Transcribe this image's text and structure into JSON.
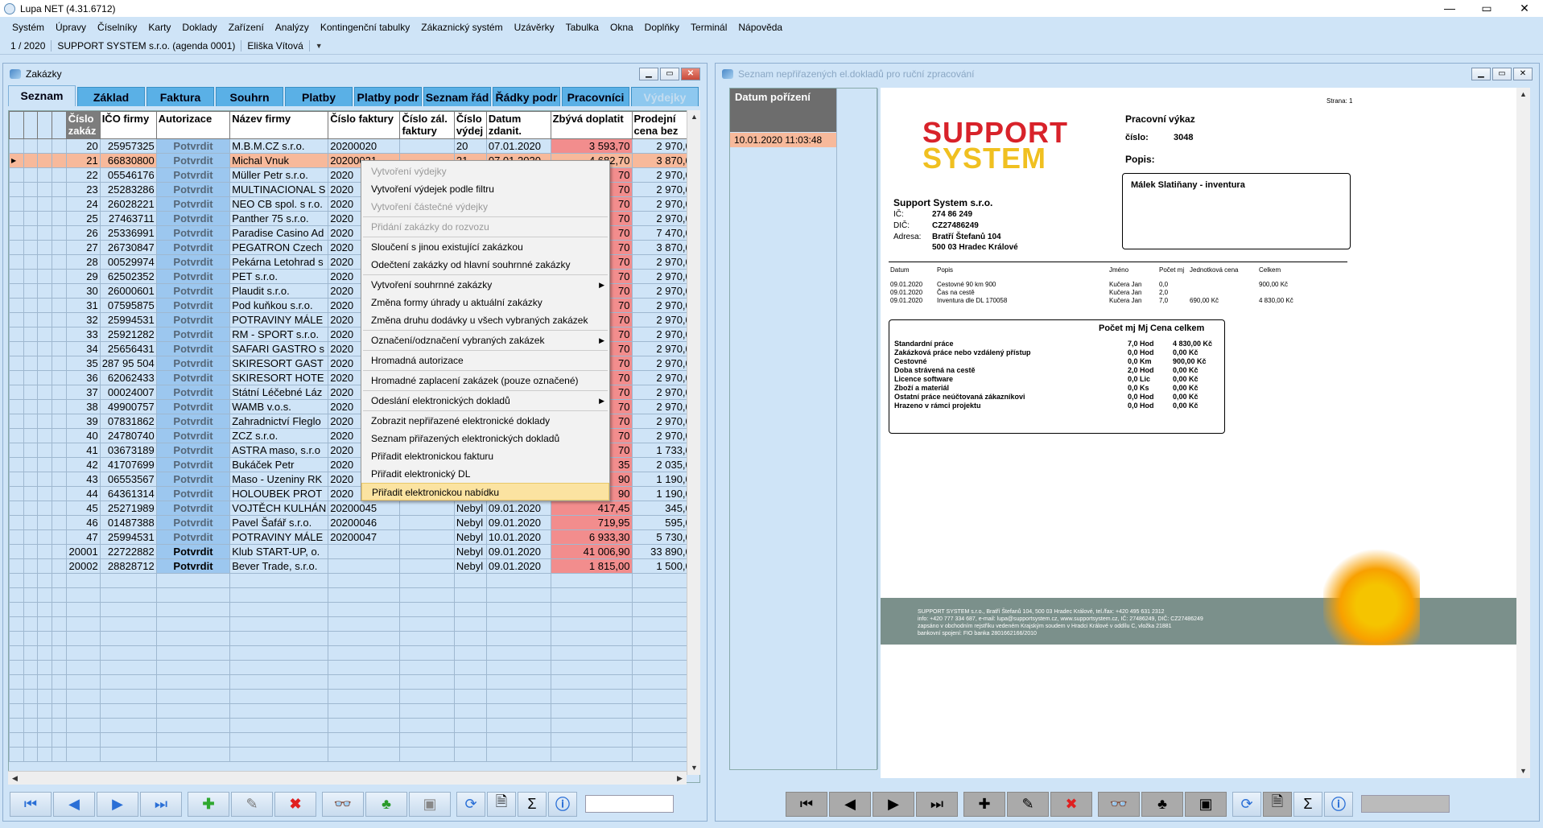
{
  "app": {
    "title": "Lupa NET (4.31.6712)",
    "minimize": "—",
    "maximize": "▭",
    "close": "✕"
  },
  "menu": [
    "Systém",
    "Úpravy",
    "Číselníky",
    "Karty",
    "Doklady",
    "Zařízení",
    "Analýzy",
    "Kontingenční tabulky",
    "Zákaznický systém",
    "Uzávěrky",
    "Tabulka",
    "Okna",
    "Doplňky",
    "Terminál",
    "Nápověda"
  ],
  "status": {
    "period": "1 / 2020",
    "company": "SUPPORT SYSTEM s.r.o.  (agenda 0001)",
    "user": "Eliška Vítová"
  },
  "left_window": {
    "title": "Zakázky",
    "tabs": [
      "Seznam",
      "Základ",
      "Faktura",
      "Souhrn",
      "Platby",
      "Platby podr",
      "Seznam řád",
      "Řádky podr",
      "Pracovníci",
      "Výdejky"
    ],
    "columns": [
      "Číslo zakáz",
      "IČO firmy",
      "Autorizace",
      "Název firmy",
      "Číslo faktury",
      "Číslo zál. faktury",
      "Číslo výdej",
      "Datum zdanit.",
      "Zbývá doplatit",
      "Prodejní cena bez"
    ],
    "rows": [
      [
        "20",
        "25957325",
        "Potvrdit",
        "M.B.M.CZ s.r.o.",
        "20200020",
        "",
        "20",
        "07.01.2020",
        "3 593,70",
        "2 970,00"
      ],
      [
        "21",
        "66830800",
        "Potvrdit",
        "Michal Vnuk",
        "20200021",
        "",
        "21",
        "07.01.2020",
        "4 682,70",
        "3 870,00"
      ],
      [
        "22",
        "05546176",
        "Potvrdit",
        "Müller Petr s.r.o.",
        "2020",
        "",
        "",
        "",
        "70",
        "2 970,00"
      ],
      [
        "23",
        "25283286",
        "Potvrdit",
        "MULTINACIONAL S",
        "2020",
        "",
        "",
        "",
        "70",
        "2 970,00"
      ],
      [
        "24",
        "26028221",
        "Potvrdit",
        "NEO CB spol. s r.o.",
        "2020",
        "",
        "",
        "",
        "70",
        "2 970,00"
      ],
      [
        "25",
        "27463711",
        "Potvrdit",
        "Panther 75 s.r.o.",
        "2020",
        "",
        "",
        "",
        "70",
        "2 970,00"
      ],
      [
        "26",
        "25336991",
        "Potvrdit",
        "Paradise Casino Ad",
        "2020",
        "",
        "",
        "",
        "70",
        "7 470,00"
      ],
      [
        "27",
        "26730847",
        "Potvrdit",
        "PEGATRON Czech",
        "2020",
        "",
        "",
        "",
        "70",
        "3 870,00"
      ],
      [
        "28",
        "00529974",
        "Potvrdit",
        "Pekárna Letohrad s",
        "2020",
        "",
        "",
        "",
        "70",
        "2 970,00"
      ],
      [
        "29",
        "62502352",
        "Potvrdit",
        "PET s.r.o.",
        "2020",
        "",
        "",
        "",
        "70",
        "2 970,00"
      ],
      [
        "30",
        "26000601",
        "Potvrdit",
        "Plaudit s.r.o.",
        "2020",
        "",
        "",
        "",
        "70",
        "2 970,00"
      ],
      [
        "31",
        "07595875",
        "Potvrdit",
        "Pod kuňkou s.r.o.",
        "2020",
        "",
        "",
        "",
        "70",
        "2 970,00"
      ],
      [
        "32",
        "25994531",
        "Potvrdit",
        "POTRAVINY MÁLE",
        "2020",
        "",
        "",
        "",
        "70",
        "2 970,00"
      ],
      [
        "33",
        "25921282",
        "Potvrdit",
        "RM - SPORT s.r.o.",
        "2020",
        "",
        "",
        "",
        "70",
        "2 970,00"
      ],
      [
        "34",
        "25656431",
        "Potvrdit",
        "SAFARI GASTRO s",
        "2020",
        "",
        "",
        "",
        "70",
        "2 970,00"
      ],
      [
        "35",
        "287 95 504",
        "Potvrdit",
        "SKIRESORT GAST",
        "2020",
        "",
        "",
        "",
        "70",
        "2 970,00"
      ],
      [
        "36",
        "62062433",
        "Potvrdit",
        "SKIRESORT HOTE",
        "2020",
        "",
        "",
        "",
        "70",
        "2 970,00"
      ],
      [
        "37",
        "00024007",
        "Potvrdit",
        "Státní Léčebné Láz",
        "2020",
        "",
        "",
        "",
        "70",
        "2 970,00"
      ],
      [
        "38",
        "49900757",
        "Potvrdit",
        "WAMB v.o.s.",
        "2020",
        "",
        "",
        "",
        "70",
        "2 970,00"
      ],
      [
        "39",
        "07831862",
        "Potvrdit",
        "Zahradnictví Fleglo",
        "2020",
        "",
        "",
        "",
        "70",
        "2 970,00"
      ],
      [
        "40",
        "24780740",
        "Potvrdit",
        "ZCZ s.r.o.",
        "2020",
        "",
        "",
        "",
        "70",
        "2 970,00"
      ],
      [
        "41",
        "03673189",
        "Potvrdit",
        "ASTRA maso, s.r.o",
        "2020",
        "",
        "",
        "",
        "70",
        "1 733,06"
      ],
      [
        "42",
        "41707699",
        "Potvrdit",
        "Bukáček Petr",
        "2020",
        "",
        "",
        "",
        "35",
        "2 035,00"
      ],
      [
        "43",
        "06553567",
        "Potvrdit",
        "Maso - Uzeniny RK",
        "2020",
        "",
        "",
        "",
        "90",
        "1 190,00"
      ],
      [
        "44",
        "64361314",
        "Potvrdit",
        "HOLOUBEK PROT",
        "2020",
        "",
        "",
        "",
        "90",
        "1 190,00"
      ],
      [
        "45",
        "25271989",
        "Potvrdit",
        "VOJTĚCH KULHÁN",
        "20200045",
        "",
        "Nebyl",
        "09.01.2020",
        "417,45",
        "345,00"
      ],
      [
        "46",
        "01487388",
        "Potvrdit",
        "Pavel Šafář s.r.o.",
        "20200046",
        "",
        "Nebyl",
        "09.01.2020",
        "719,95",
        "595,00"
      ],
      [
        "47",
        "25994531",
        "Potvrdit",
        "POTRAVINY MÁLE",
        "20200047",
        "",
        "Nebyl",
        "10.01.2020",
        "6 933,30",
        "5 730,00"
      ],
      [
        "20001",
        "22722882",
        "Potvrdit",
        "Klub START-UP, o.",
        "",
        "",
        "Nebyl",
        "09.01.2020",
        "41 006,90",
        "33 890,00"
      ],
      [
        "20002",
        "28828712",
        "Potvrdit",
        "Bever Trade, s.r.o.",
        "",
        "",
        "Nebyl",
        "09.01.2020",
        "1 815,00",
        "1 500,00"
      ]
    ],
    "context_menu": [
      {
        "label": "Vytvoření výdejky",
        "disabled": true
      },
      {
        "label": "Vytvoření výdejek podle filtru"
      },
      {
        "label": "Vytvoření částečné výdejky",
        "disabled": true
      },
      {
        "sep": true
      },
      {
        "label": "Přidání zakázky do rozvozu",
        "disabled": true
      },
      {
        "sep": true
      },
      {
        "label": "Sloučení s jinou existující zakázkou"
      },
      {
        "label": "Odečtení zakázky od hlavní souhrnné zakázky"
      },
      {
        "sep": true
      },
      {
        "label": "Vytvoření souhrnné zakázky",
        "submenu": true
      },
      {
        "label": "Změna formy úhrady u aktuální zakázky"
      },
      {
        "label": "Změna druhu dodávky u všech vybraných zakázek"
      },
      {
        "sep": true
      },
      {
        "label": "Označení/odznačení vybraných zakázek",
        "submenu": true
      },
      {
        "sep": true
      },
      {
        "label": "Hromadná autorizace"
      },
      {
        "sep": true
      },
      {
        "label": "Hromadné zaplacení zakázek (pouze označené)"
      },
      {
        "sep": true
      },
      {
        "label": "Odeslání elektronických dokladů",
        "submenu": true
      },
      {
        "sep": true
      },
      {
        "label": "Zobrazit nepřiřazené elektronické doklady"
      },
      {
        "label": "Seznam přiřazených elektronických dokladů"
      },
      {
        "label": "Přiřadit elektronickou fakturu"
      },
      {
        "label": "Přiřadit elektronický DL"
      },
      {
        "label": "Přiřadit elektronickou nabídku",
        "highlight": true
      }
    ]
  },
  "right_window": {
    "title": "Seznam nepřiřazených el.dokladů pro ruční zpracování",
    "column": "Datum pořízení",
    "rows": [
      "10.01.2020 11:03:48"
    ],
    "document": {
      "page": "Strana: 1",
      "logo_line1": "SUPPORT",
      "logo_line2": "SYSTEM",
      "heading": "Pracovní výkaz",
      "number_label": "číslo:",
      "number": "3048",
      "desc_label": "Popis:",
      "desc": "Málek Slatiňany - inventura",
      "company": "Support System s.r.o.",
      "ic_label": "IČ:",
      "ic": "274 86 249",
      "dic_label": "DIČ:",
      "dic": "CZ27486249",
      "addr_label": "Adresa:",
      "addr1": "Bratří Štefanů 104",
      "addr2": "500 03 Hradec Králové",
      "items_header": [
        "Datum",
        "Popis",
        "Jméno",
        "Počet mj",
        "Jednotková cena",
        "Celkem"
      ],
      "items": [
        [
          "09.01.2020",
          "Cestovné 90 km 900",
          "Kučera Jan",
          "0,0",
          "",
          "900,00 Kč"
        ],
        [
          "09.01.2020",
          "Čas na cestě",
          "Kučera Jan",
          "2,0",
          "",
          ""
        ],
        [
          "09.01.2020",
          "Inventura dle DL 170058",
          "Kučera Jan",
          "7,0",
          "690,00 Kč",
          "4 830,00 Kč"
        ]
      ],
      "summary_header": [
        "Počet mj Mj",
        "Cena celkem"
      ],
      "summary": [
        [
          "Standardní práce",
          "7,0 Hod",
          "4 830,00 Kč"
        ],
        [
          "Zakázková práce nebo vzdálený přístup",
          "0,0 Hod",
          "0,00 Kč"
        ],
        [
          "Cestovné",
          "0,0 Km",
          "900,00 Kč"
        ],
        [
          "Doba strávená na cestě",
          "2,0 Hod",
          "0,00 Kč"
        ],
        [
          "Licence software",
          "0,0 Lic",
          "0,00 Kč"
        ],
        [
          "Zboží a materiál",
          "0,0 Ks",
          "0,00 Kč"
        ],
        [
          "Ostatní práce neúčtovaná zákazníkovi",
          "0,0 Hod",
          "0,00 Kč"
        ],
        [
          "Hrazeno v rámci projektu",
          "0,0 Hod",
          "0,00 Kč"
        ]
      ],
      "footer": [
        "SUPPORT SYSTEM s.r.o., Bratří Štefanů 104, 500 03 Hradec Králové, tel./fax: +420 495 631 2312",
        "info: +420 777 334 687, e-mail: lupa@supportsystem.cz, www.supportsystem.cz, IČ: 27486249, DIČ: CZ27486249",
        "zapsáno v obchodním rejstříku vedeném Krajským soudem v Hradci Králové v oddílu C, vložka 21881",
        "bankovní spojení: FIO banka 2801662166/2010"
      ]
    }
  },
  "colors": {
    "bg": "#cfe4f7",
    "tab": "#5ab0e6",
    "authorize": "#9cc7ef",
    "owe": "#f28d8d",
    "selected": "#f7b99b",
    "menu_highlight": "#fbe3a1",
    "logo_red": "#d8222a"
  }
}
